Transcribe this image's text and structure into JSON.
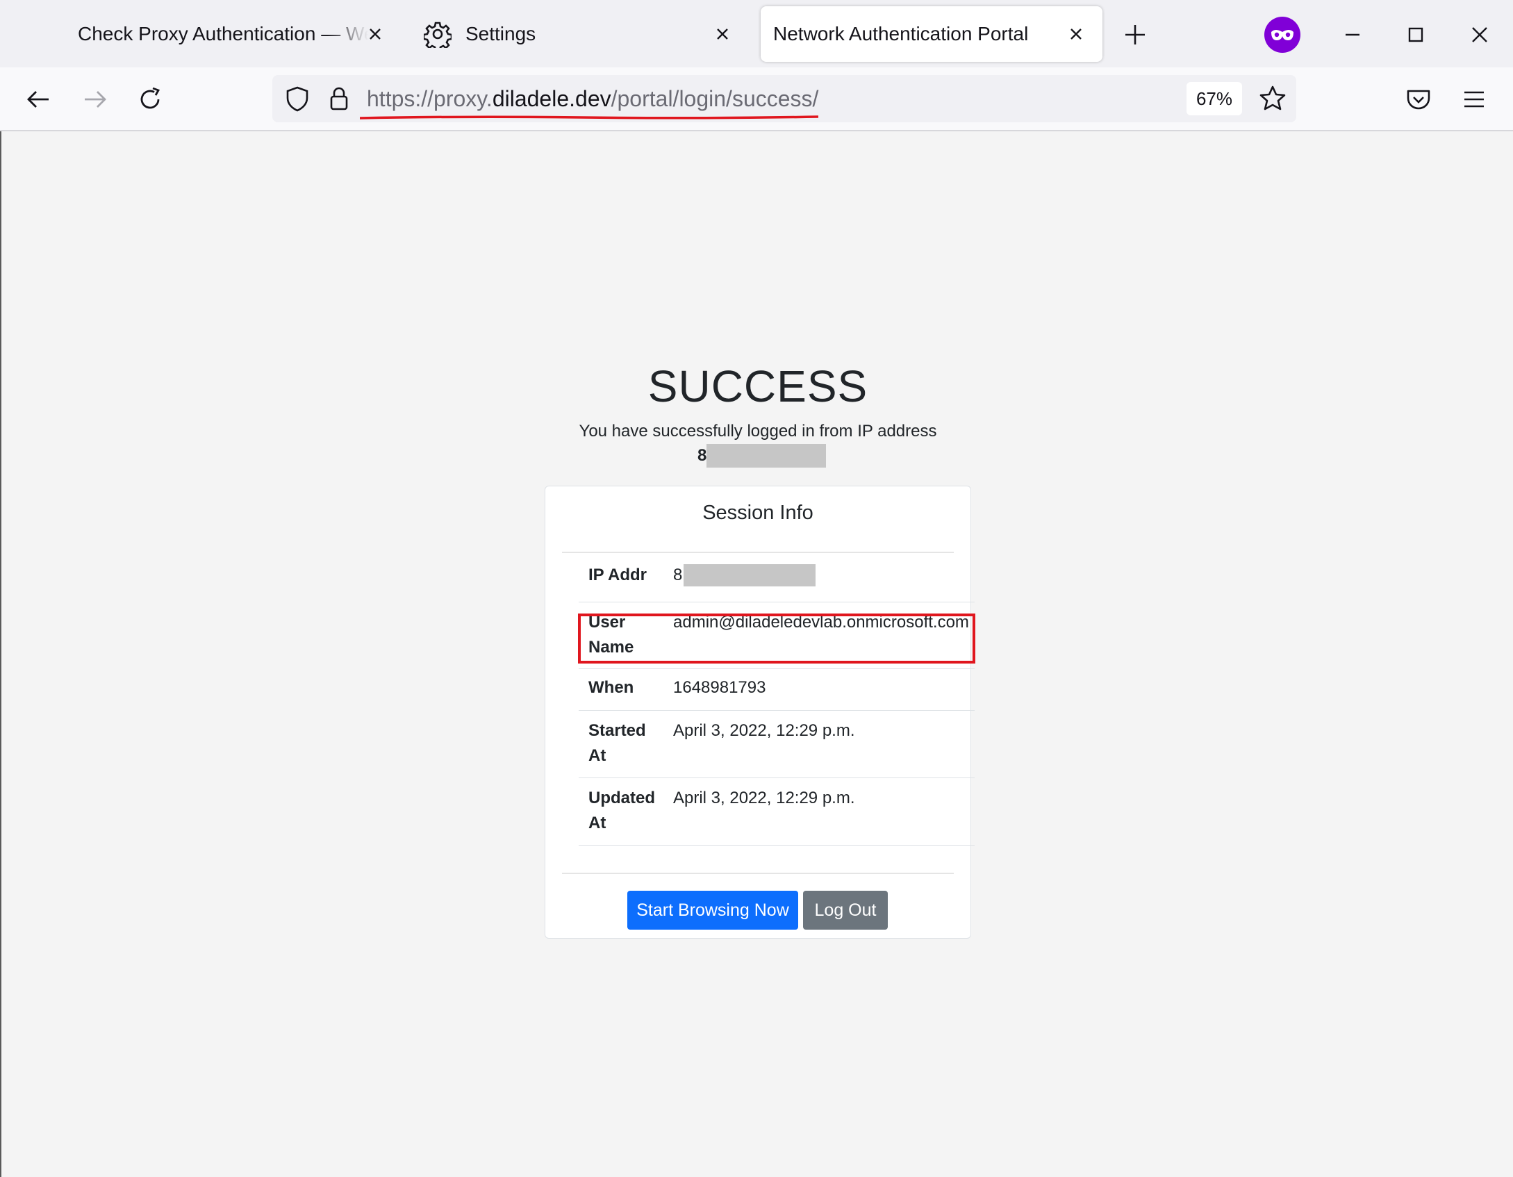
{
  "tabs": [
    {
      "label": "Check Proxy Authentication — Web"
    },
    {
      "label": "Settings"
    },
    {
      "label": "Network Authentication Portal"
    }
  ],
  "urlbar": {
    "prefix": "https://proxy.",
    "host": "diladele.dev",
    "path": "/portal/login/success/",
    "zoom": "67%"
  },
  "page": {
    "title": "SUCCESS",
    "message": "You have successfully logged in from IP address",
    "ip_visible": "8"
  },
  "session": {
    "header": "Session Info",
    "rows": [
      {
        "label": "IP Addr",
        "value": "8"
      },
      {
        "label": "User Name",
        "value": "admin@diladeledevlab.onmicrosoft.com"
      },
      {
        "label": "When",
        "value": "1648981793"
      },
      {
        "label": "Started At",
        "value": "April 3, 2022, 12:29 p.m."
      },
      {
        "label": "Updated At",
        "value": "April 3, 2022, 12:29 p.m."
      }
    ]
  },
  "buttons": {
    "start": "Start Browsing Now",
    "logout": "Log Out"
  },
  "colors": {
    "primary": "#0d6efd",
    "secondary": "#6c757d",
    "highlight": "#e0161e",
    "extension": "#8000d7"
  }
}
